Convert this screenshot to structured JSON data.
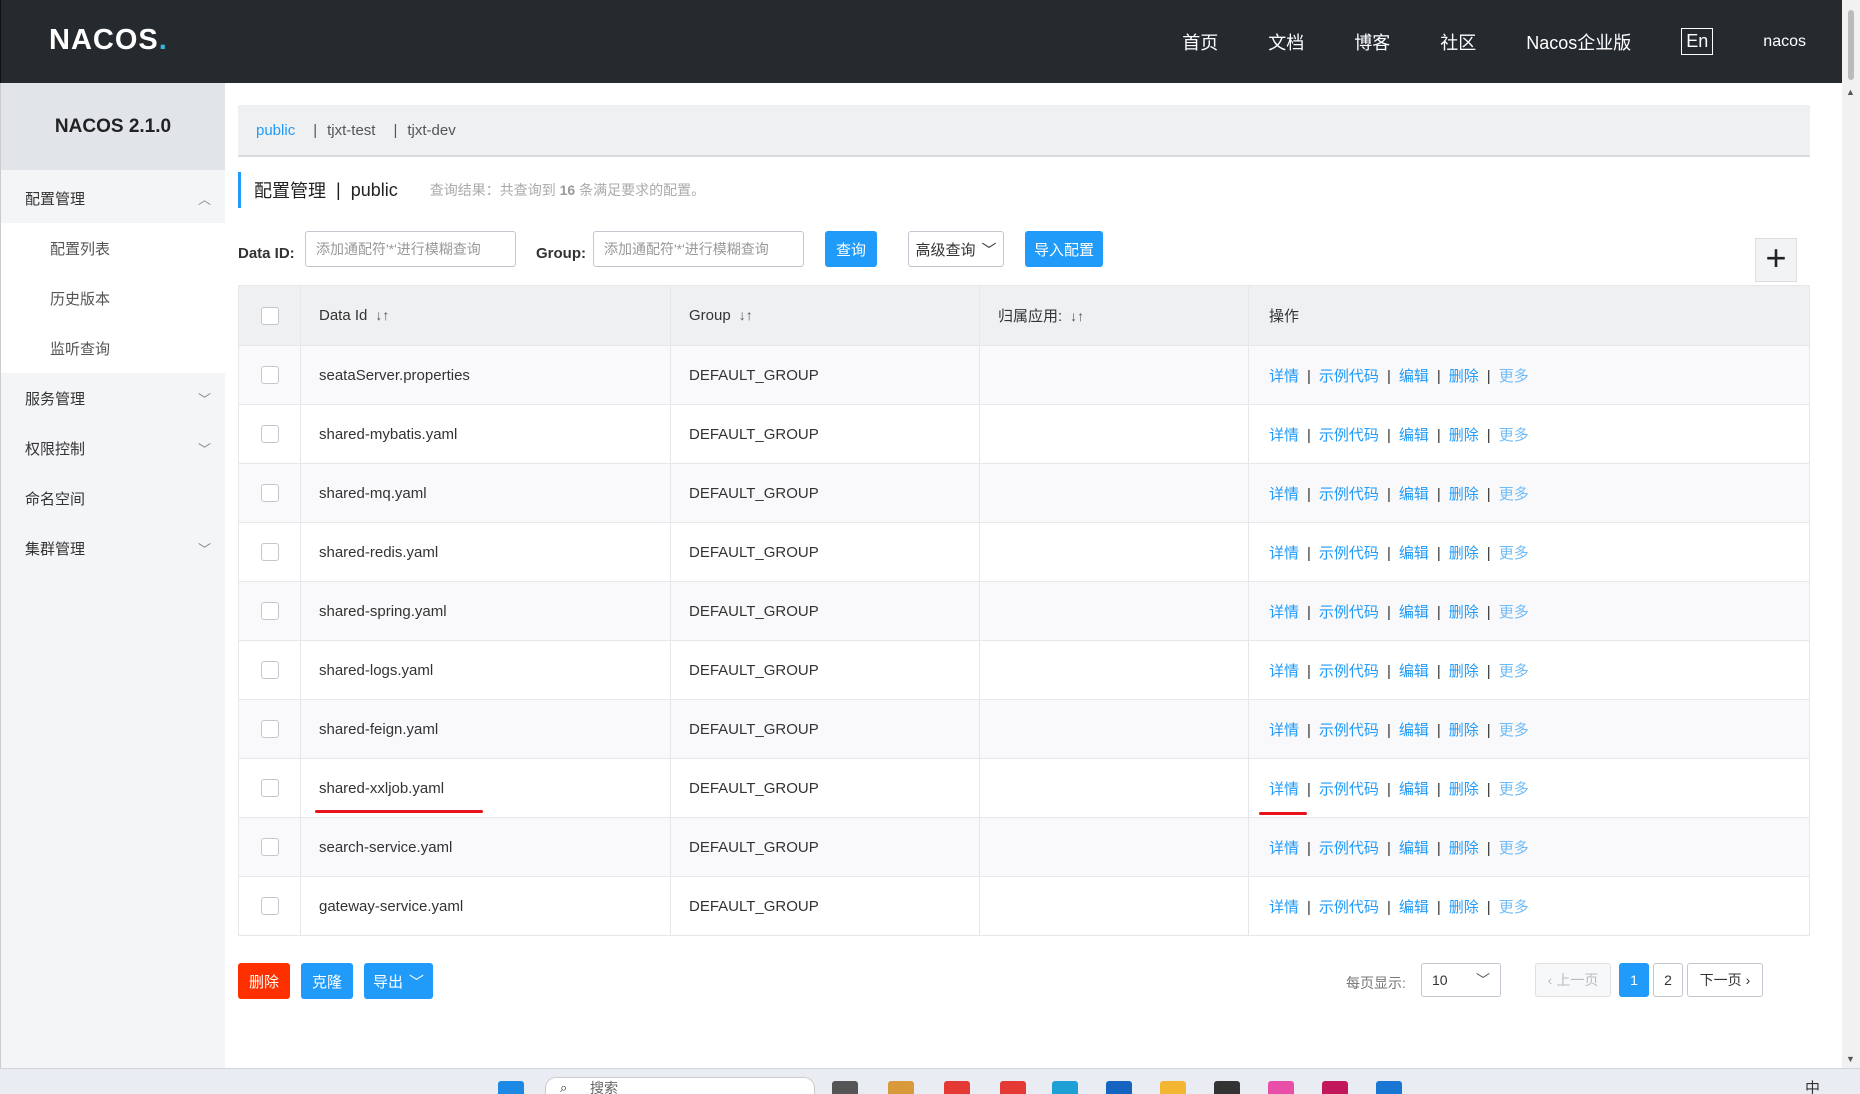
{
  "header": {
    "logo": "NACOS",
    "logo_dot": ".",
    "nav": [
      "首页",
      "文档",
      "博客",
      "社区",
      "Nacos企业版"
    ],
    "lang": "En",
    "user": "nacos"
  },
  "sidebar": {
    "title": "NACOS 2.1.0",
    "items": [
      {
        "label": "配置管理",
        "chevron": "︿"
      },
      {
        "label": "配置列表"
      },
      {
        "label": "历史版本"
      },
      {
        "label": "监听查询"
      },
      {
        "label": "服务管理",
        "chevron": "﹀"
      },
      {
        "label": "权限控制",
        "chevron": "﹀"
      },
      {
        "label": "命名空间"
      },
      {
        "label": "集群管理",
        "chevron": "﹀"
      }
    ]
  },
  "namespaces": {
    "items": [
      "public",
      "tjxt-test",
      "tjxt-dev"
    ],
    "separator": "|"
  },
  "page": {
    "title": "配置管理",
    "sep": "|",
    "namespace": "public",
    "info_prefix": "查询结果：共查询到",
    "info_count": "16",
    "info_suffix": "条满足要求的配置。"
  },
  "search": {
    "data_id_label": "Data ID:",
    "data_id_placeholder": "添加通配符'*'进行模糊查询",
    "group_label": "Group:",
    "group_placeholder": "添加通配符'*'进行模糊查询",
    "query_btn": "查询",
    "advanced_btn": "高级查询",
    "import_btn": "导入配置",
    "add_btn": "+"
  },
  "table": {
    "headers": [
      "Data Id",
      "Group",
      "归属应用:",
      "操作"
    ],
    "sort_icon": "↓↑",
    "rows": [
      {
        "data_id": "seataServer.properties",
        "group": "DEFAULT_GROUP",
        "app": ""
      },
      {
        "data_id": "shared-mybatis.yaml",
        "group": "DEFAULT_GROUP",
        "app": ""
      },
      {
        "data_id": "shared-mq.yaml",
        "group": "DEFAULT_GROUP",
        "app": ""
      },
      {
        "data_id": "shared-redis.yaml",
        "group": "DEFAULT_GROUP",
        "app": ""
      },
      {
        "data_id": "shared-spring.yaml",
        "group": "DEFAULT_GROUP",
        "app": ""
      },
      {
        "data_id": "shared-logs.yaml",
        "group": "DEFAULT_GROUP",
        "app": ""
      },
      {
        "data_id": "shared-feign.yaml",
        "group": "DEFAULT_GROUP",
        "app": ""
      },
      {
        "data_id": "shared-xxljob.yaml",
        "group": "DEFAULT_GROUP",
        "app": ""
      },
      {
        "data_id": "search-service.yaml",
        "group": "DEFAULT_GROUP",
        "app": ""
      },
      {
        "data_id": "gateway-service.yaml",
        "group": "DEFAULT_GROUP",
        "app": ""
      }
    ],
    "ops": [
      "详情",
      "示例代码",
      "编辑",
      "删除",
      "更多"
    ],
    "op_sep": "|"
  },
  "footer": {
    "delete_btn": "删除",
    "clone_btn": "克隆",
    "export_btn": "导出",
    "page_size_label": "每页显示:",
    "page_size": "10",
    "prev": "上一页",
    "pages": [
      "1",
      "2"
    ],
    "next": "下一页",
    "current_page": 1
  },
  "taskbar": {
    "search_text": "搜索",
    "tray_text": "中"
  },
  "colors": {
    "header_bg": "#252a2f",
    "primary": "#209bfa",
    "danger": "#ff3000",
    "annotation": "#e8121c"
  }
}
